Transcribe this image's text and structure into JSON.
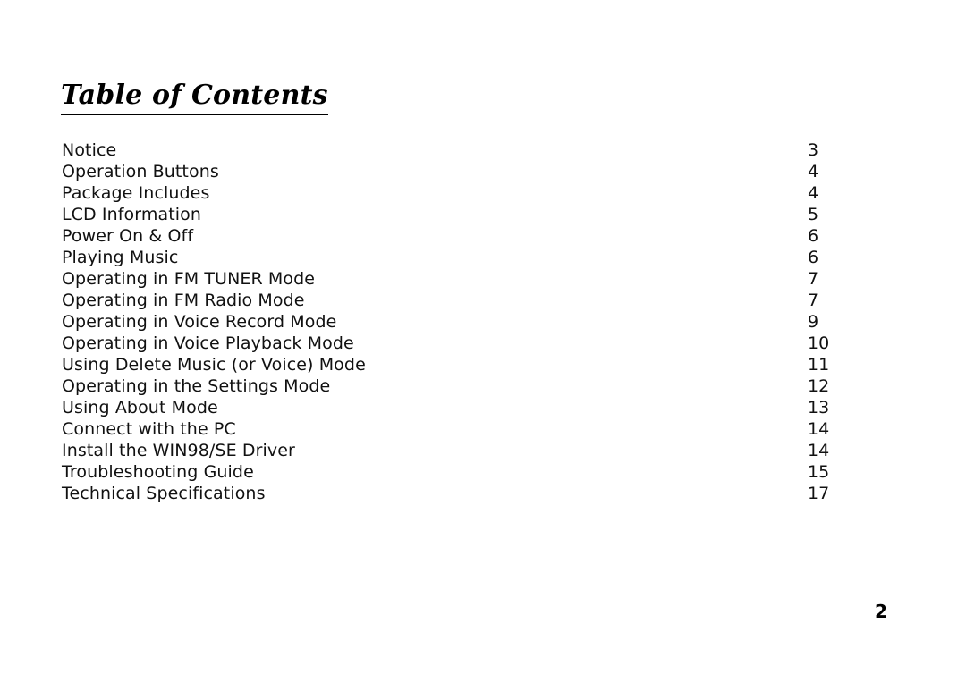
{
  "document": {
    "title": "Table of Contents",
    "footer_page_number": "2",
    "text_color": "#111111",
    "background_color": "#ffffff"
  },
  "toc": {
    "entries": [
      {
        "label": "Notice",
        "page": "3"
      },
      {
        "label": "Operation Buttons",
        "page": "4"
      },
      {
        "label": "Package Includes",
        "page": "4"
      },
      {
        "label": "LCD Information",
        "page": "5"
      },
      {
        "label": "Power On & Off",
        "page": "6"
      },
      {
        "label": "Playing Music",
        "page": "6"
      },
      {
        "label": "Operating in FM TUNER Mode",
        "page": "7"
      },
      {
        "label": "Operating in FM Radio Mode",
        "page": "7"
      },
      {
        "label": "Operating in Voice Record Mode",
        "page": "9"
      },
      {
        "label": "Operating in Voice Playback Mode",
        "page": "10"
      },
      {
        "label": "Using Delete Music (or Voice) Mode",
        "page": "11"
      },
      {
        "label": "Operating in the Settings Mode",
        "page": "12"
      },
      {
        "label": "Using About Mode",
        "page": "13"
      },
      {
        "label": "Connect with the PC",
        "page": "14"
      },
      {
        "label": "Install the WIN98/SE Driver",
        "page": "14"
      },
      {
        "label": "Troubleshooting Guide",
        "page": "15"
      },
      {
        "label": "Technical Specifications",
        "page": "17"
      }
    ]
  }
}
